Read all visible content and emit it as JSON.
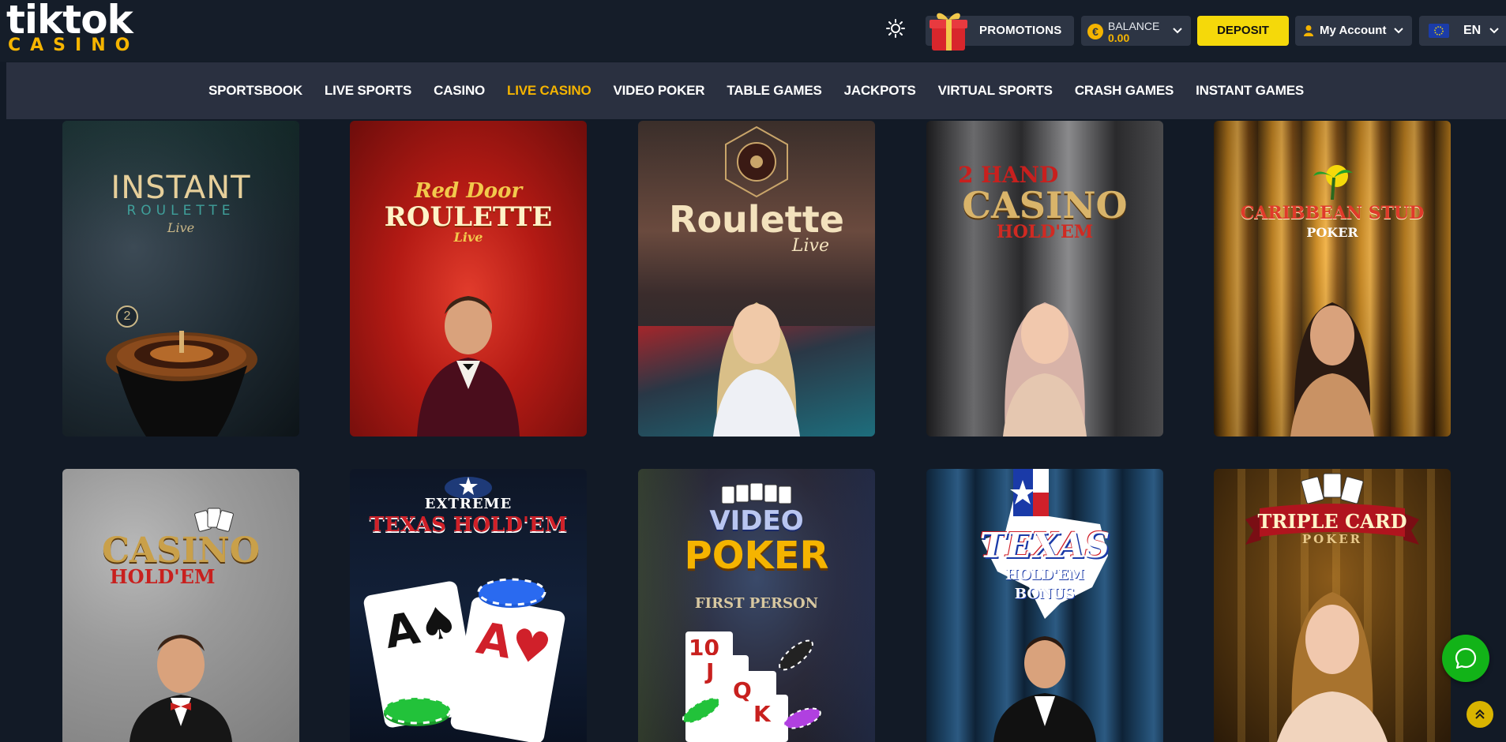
{
  "logo": {
    "top": "tiktok",
    "bottom": "CASINO"
  },
  "header": {
    "promotions_label": "PROMOTIONS",
    "balance_label": "BALANCE",
    "balance_value": "0.00",
    "balance_currency_symbol": "€",
    "deposit_label": "DEPOSIT",
    "account_label": "My Account",
    "language_label": "EN"
  },
  "colors": {
    "accent": "#f5b400",
    "deposit": "#f5d90a",
    "chat": "#12b318",
    "background": "#121a26",
    "nav": "#2a3040"
  },
  "nav": {
    "items": [
      {
        "label": "SPORTSBOOK"
      },
      {
        "label": "LIVE SPORTS"
      },
      {
        "label": "CASINO"
      },
      {
        "label": "LIVE CASINO",
        "active": true
      },
      {
        "label": "VIDEO POKER"
      },
      {
        "label": "TABLE GAMES"
      },
      {
        "label": "JACKPOTS"
      },
      {
        "label": "VIRTUAL SPORTS"
      },
      {
        "label": "CRASH GAMES"
      },
      {
        "label": "INSTANT GAMES"
      }
    ]
  },
  "games": [
    {
      "line1": "INSTANT",
      "line2": "ROULETTE",
      "line3": "Live",
      "badge": "2"
    },
    {
      "line1": "Red Door",
      "line2": "ROULETTE",
      "line3": "Live"
    },
    {
      "line1": "Roulette",
      "line2": "Live"
    },
    {
      "line1": "2 HAND",
      "line2": "CASINO",
      "line3": "HOLD'EM"
    },
    {
      "line1": "CARIBBEAN STUD",
      "line2": "POKER"
    },
    {
      "line1": "CASINO",
      "line2": "HOLD'EM"
    },
    {
      "line1": "EXTREME",
      "line2": "TEXAS HOLD'EM"
    },
    {
      "line1": "VIDEO",
      "line2": "POKER",
      "line3": "FIRST PERSON"
    },
    {
      "line1": "TEXAS",
      "line2": "HOLD'EM",
      "line3": "BONUS"
    },
    {
      "line1": "TRIPLE CARD",
      "line2": "POKER"
    }
  ]
}
